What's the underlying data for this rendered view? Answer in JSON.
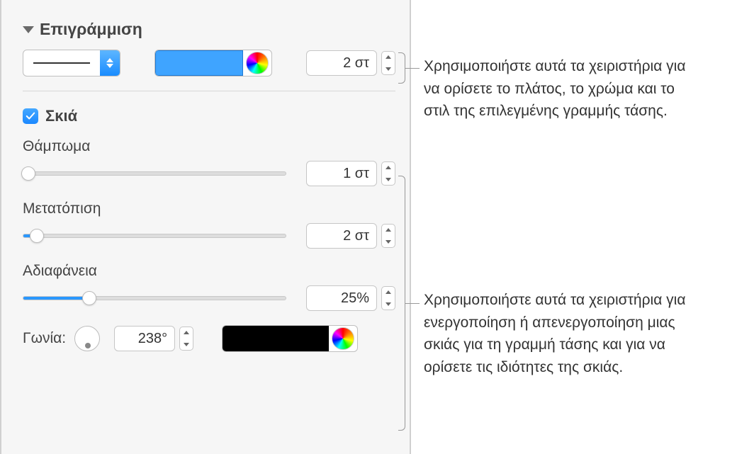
{
  "stroke": {
    "section_title": "Επιγράμμιση",
    "width_value": "2 στ",
    "color": "#3fa4ff"
  },
  "shadow": {
    "label": "Σκιά",
    "checked": true,
    "blur": {
      "label": "Θάμπωμα",
      "value": "1 στ",
      "percent": 2
    },
    "offset": {
      "label": "Μετατόπιση",
      "value": "2 στ",
      "percent": 5
    },
    "opacity": {
      "label": "Αδιαφάνεια",
      "value": "25%",
      "percent": 25
    },
    "angle": {
      "label": "Γωνία:",
      "value": "238°"
    },
    "color": "#000000"
  },
  "callouts": {
    "stroke": "Χρησιμοποιήστε αυτά τα χειριστήρια για να ορίσετε το πλάτος, το χρώμα και το στιλ της επιλεγμένης γραμμής τάσης.",
    "shadow": "Χρησιμοποιήστε αυτά τα χειριστήρια για ενεργοποίηση ή απενεργοποίηση μιας σκιάς για τη γραμμή τάσης και για να ορίσετε τις ιδιότητες της σκιάς."
  }
}
